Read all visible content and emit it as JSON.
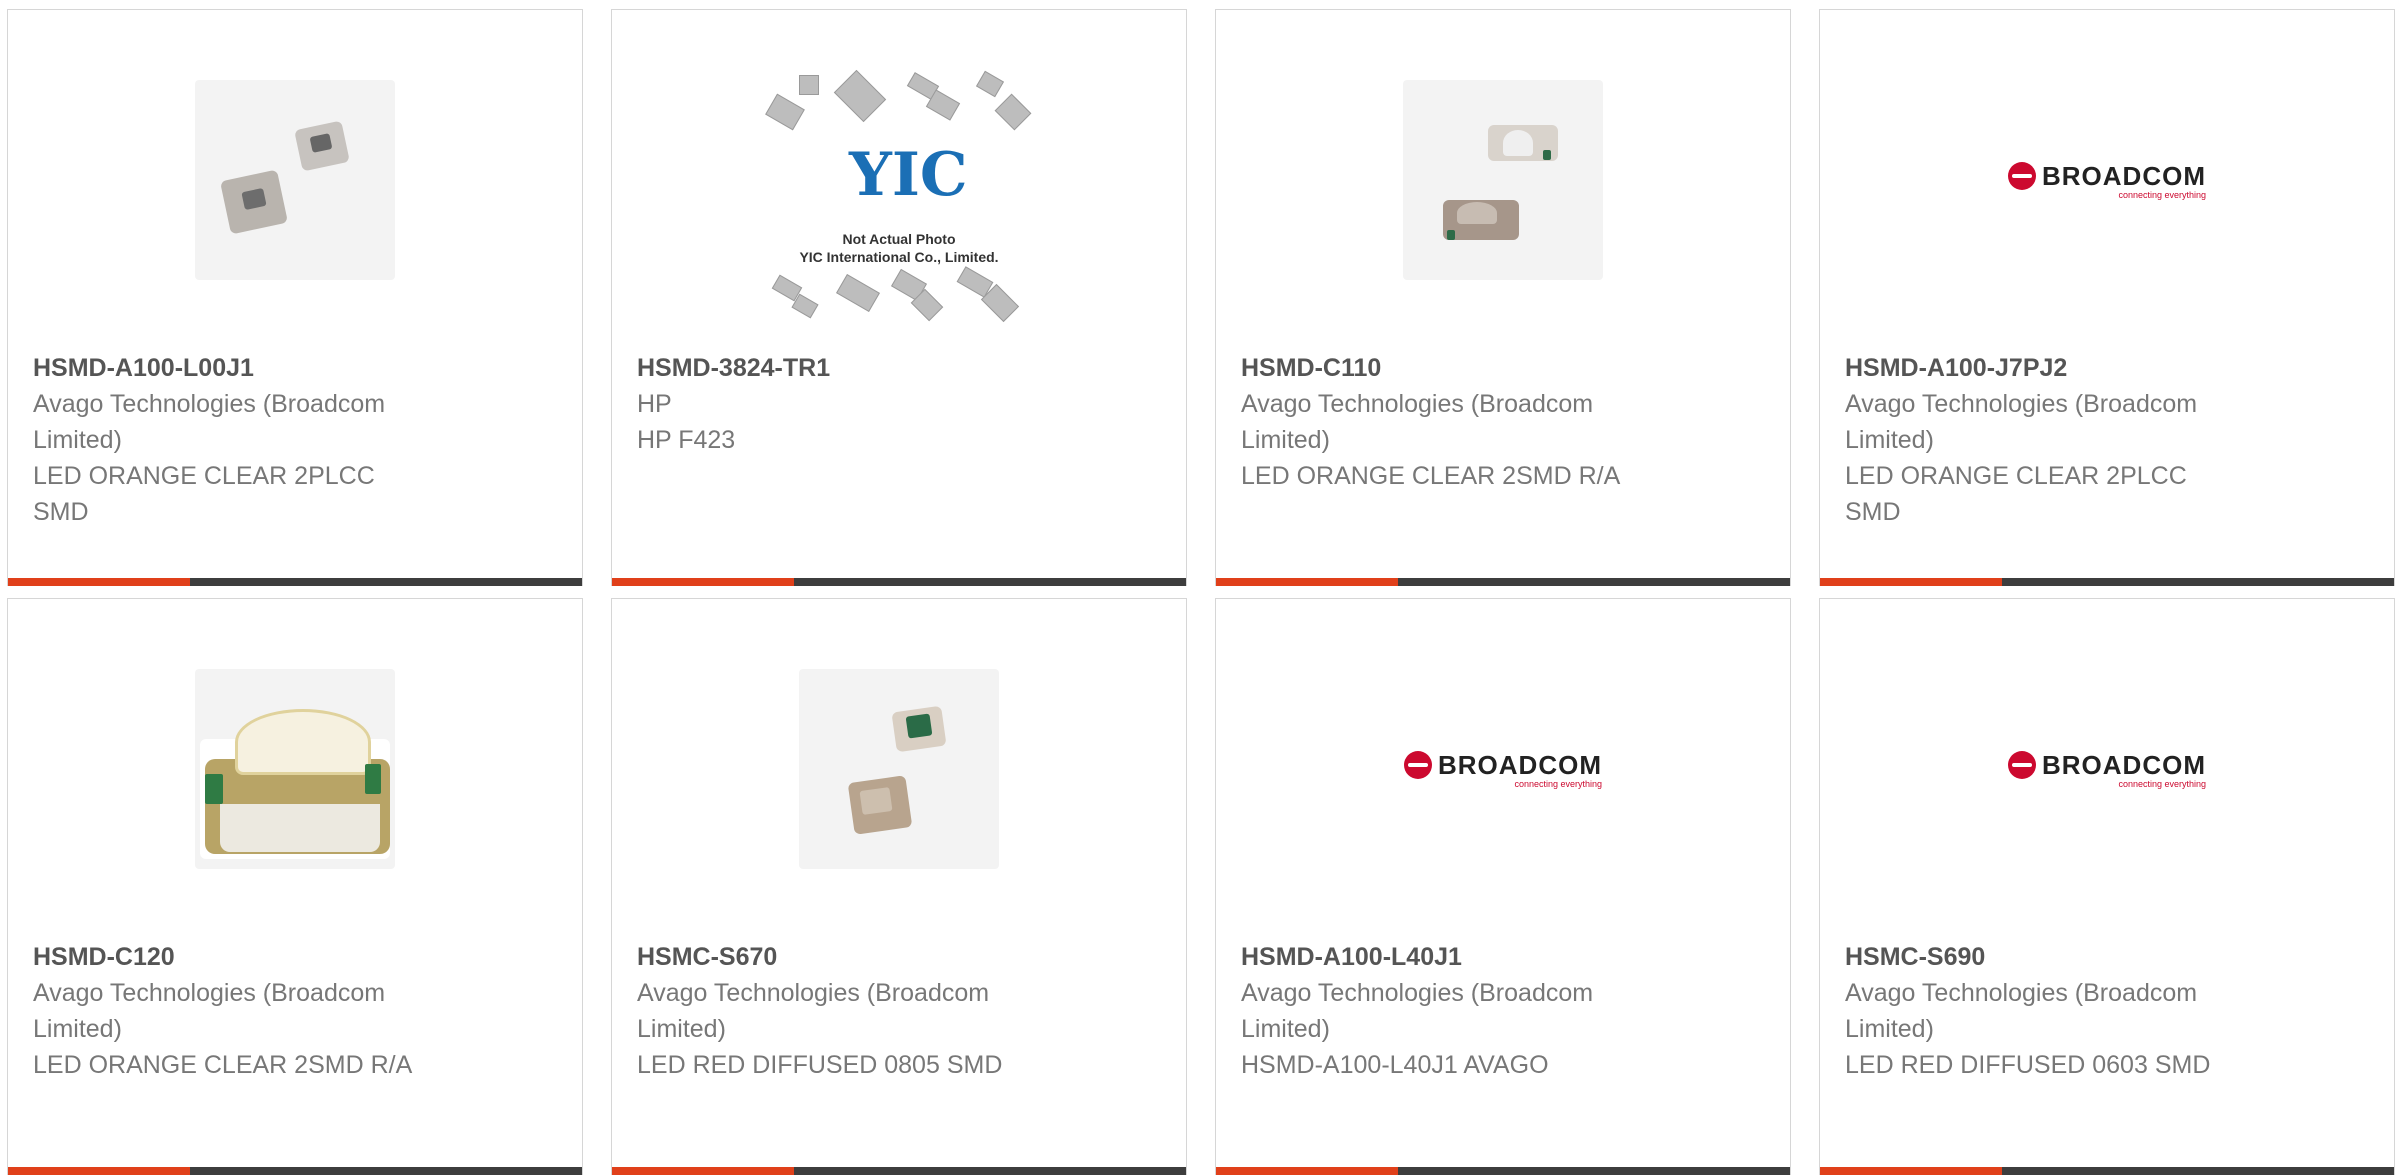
{
  "products": [
    {
      "part": "HSMD-A100-L00J1",
      "lines": [
        "Avago Technologies (Broadcom",
        "Limited)",
        "LED ORANGE CLEAR 2PLCC",
        "SMD"
      ],
      "image": "led-photo"
    },
    {
      "part": "HSMD-3824-TR1",
      "lines": [
        "HP",
        "HP F423"
      ],
      "image": "yic-not-actual-photo",
      "image_caption": [
        "Not Actual Photo",
        "YIC International Co., Limited."
      ],
      "image_logo": "YIC"
    },
    {
      "part": "HSMD-C110",
      "lines": [
        "Avago Technologies (Broadcom",
        "Limited)",
        "LED ORANGE CLEAR 2SMD R/A"
      ],
      "image": "led-photo"
    },
    {
      "part": "HSMD-A100-J7PJ2",
      "lines": [
        "Avago Technologies (Broadcom",
        "Limited)",
        "LED ORANGE CLEAR 2PLCC",
        "SMD"
      ],
      "image": "broadcom-logo"
    },
    {
      "part": "HSMD-C120",
      "lines": [
        "Avago Technologies (Broadcom",
        "Limited)",
        "LED ORANGE CLEAR 2SMD R/A"
      ],
      "image": "led-photo"
    },
    {
      "part": "HSMC-S670",
      "lines": [
        "Avago Technologies (Broadcom",
        "Limited)",
        "LED RED DIFFUSED 0805 SMD"
      ],
      "image": "led-photo"
    },
    {
      "part": "HSMD-A100-L40J1",
      "lines": [
        "Avago Technologies (Broadcom",
        "Limited)",
        "HSMD-A100-L40J1 AVAGO"
      ],
      "image": "broadcom-logo"
    },
    {
      "part": "HSMC-S690",
      "lines": [
        "Avago Technologies (Broadcom",
        "Limited)",
        "LED RED DIFFUSED 0603 SMD"
      ],
      "image": "broadcom-logo"
    }
  ],
  "broadcom": {
    "word": "BROADCOM",
    "tagline": "connecting everything"
  },
  "colors": {
    "accent": "#e0401a",
    "bar": "#3d3d3d",
    "border": "#d6d6d6",
    "text": "#777777",
    "part": "#555555"
  }
}
